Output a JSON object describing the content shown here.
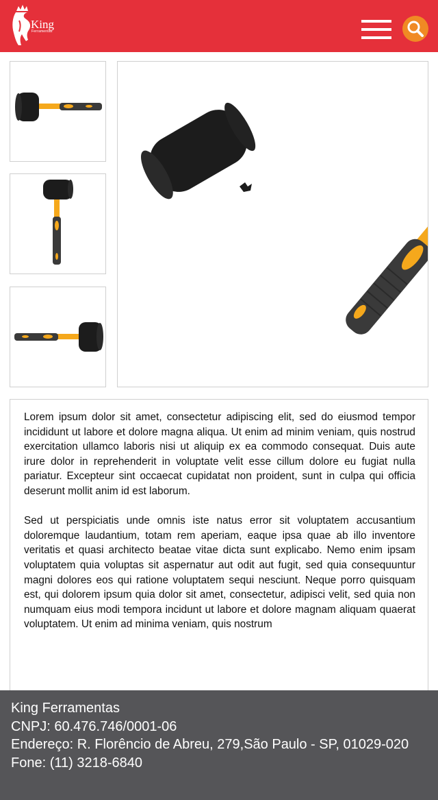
{
  "header": {
    "logo_text": "King",
    "logo_subtext": "Ferramentas",
    "menu_icon": "hamburger-menu-icon",
    "search_icon": "search-icon",
    "colors": {
      "bar": "#e5303a",
      "search_button": "#f08a24"
    }
  },
  "gallery": {
    "thumbnails": [
      {
        "view": "horizontal-head-left"
      },
      {
        "view": "vertical-head-top"
      },
      {
        "view": "horizontal-head-right"
      }
    ],
    "main": {
      "view": "diagonal"
    },
    "colors": {
      "head": "#1c1c1c",
      "handle": "#f5a81c",
      "grip": "#3a3a3a"
    }
  },
  "description": {
    "paragraphs": [
      "Lorem ipsum dolor sit amet, consectetur adipiscing elit, sed do eiusmod tempor incididunt ut labore et dolore magna aliqua. Ut enim ad minim veniam, quis nostrud exercitation ullamco laboris nisi ut aliquip ex ea commodo consequat. Duis aute irure dolor in reprehenderit in voluptate velit esse cillum dolore eu fugiat nulla pariatur. Excepteur sint occaecat cupidatat non proident, sunt in culpa qui officia deserunt mollit anim id est laborum.",
      "Sed ut perspiciatis unde omnis iste natus error sit voluptatem accusantium doloremque laudantium, totam rem aperiam, eaque ipsa quae ab illo inventore veritatis et quasi architecto beatae vitae dicta sunt explicabo. Nemo enim ipsam voluptatem quia voluptas sit aspernatur aut odit aut fugit, sed quia consequuntur magni dolores eos qui ratione voluptatem sequi nesciunt. Neque porro quisquam est, qui dolorem ipsum quia dolor sit amet, consectetur, adipisci velit, sed quia non numquam eius modi tempora incidunt ut labore et dolore magnam aliquam quaerat voluptatem. Ut enim ad minima veniam, quis nostrum"
    ]
  },
  "footer": {
    "company": "King Ferramentas",
    "cnpj": "CNPJ: 60.476.746/0001-06",
    "address": "Endereço: R. Florêncio de Abreu, 279,São Paulo - SP, 01029-020",
    "phone": "Fone:  (11) 3218-6840",
    "colors": {
      "background": "#555558"
    }
  }
}
